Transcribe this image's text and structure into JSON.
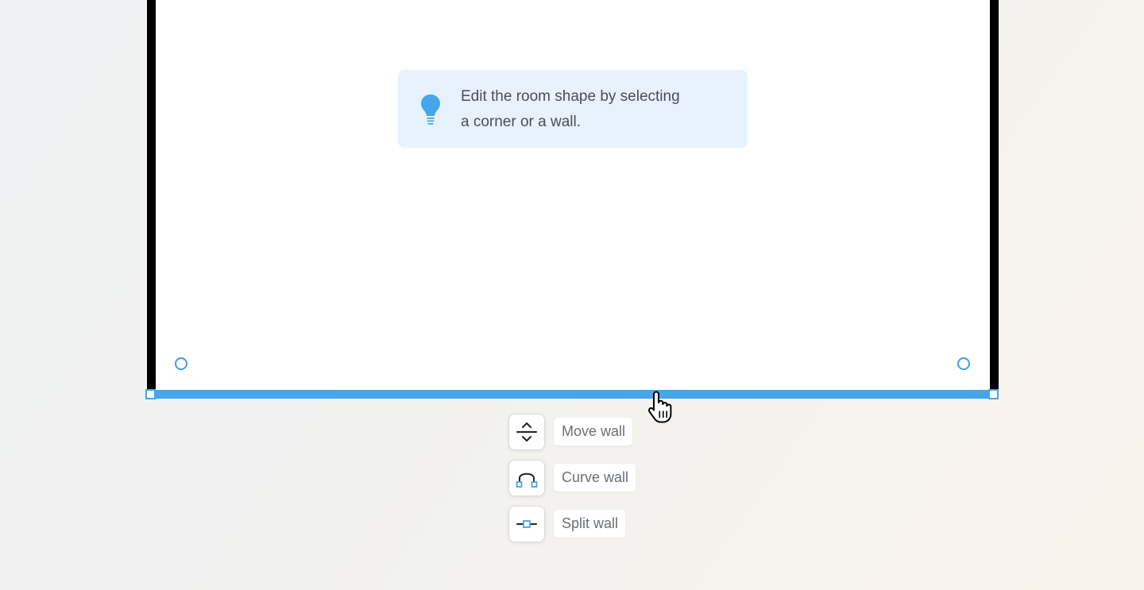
{
  "tip": {
    "line1": "Edit the room shape by selecting",
    "line2": "a corner or a wall.",
    "icon": "lightbulb-icon"
  },
  "actions": [
    {
      "label": "Move wall",
      "icon": "move-wall-icon"
    },
    {
      "label": "Curve wall",
      "icon": "curve-wall-icon"
    },
    {
      "label": "Split wall",
      "icon": "split-wall-icon"
    }
  ],
  "colors": {
    "accent": "#45a6ea",
    "wall": "#000000",
    "tip_background": "#e7f2fc"
  }
}
